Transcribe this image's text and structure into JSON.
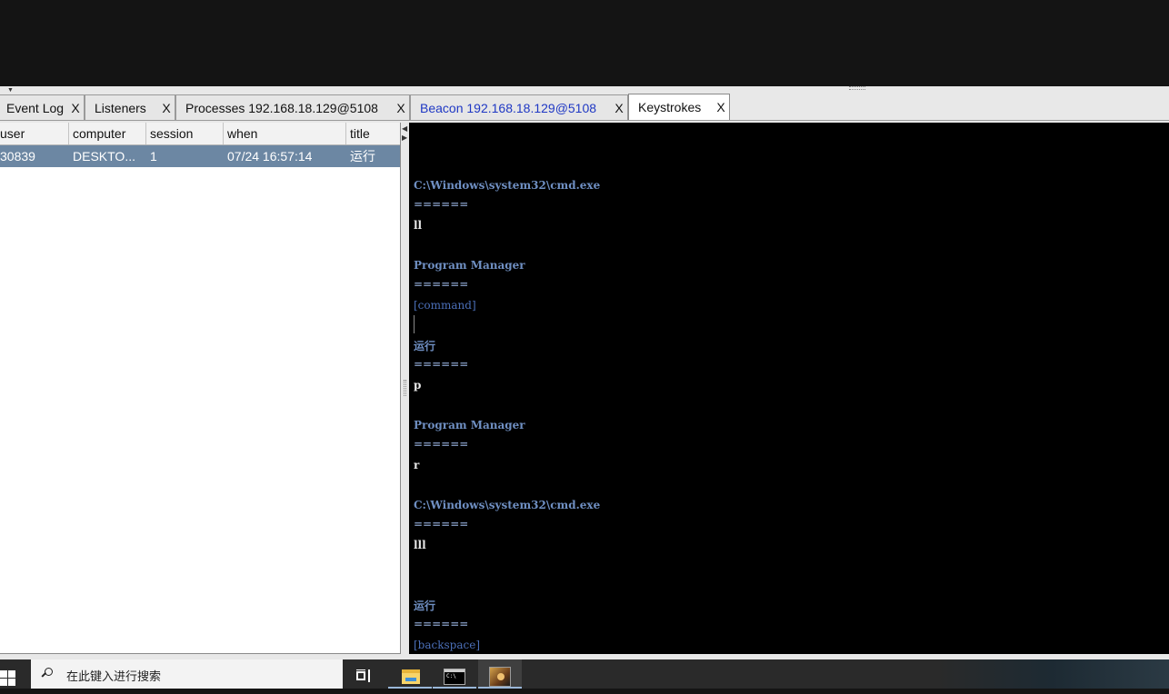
{
  "tabs": [
    {
      "label": "Event Log",
      "close": "X"
    },
    {
      "label": "Listeners",
      "close": "X"
    },
    {
      "label": "Processes 192.168.18.129@5108",
      "close": "X"
    },
    {
      "label": "Beacon 192.168.18.129@5108",
      "close": "X"
    },
    {
      "label": "Keystrokes",
      "close": "X"
    }
  ],
  "table": {
    "headers": [
      "user",
      "computer",
      "session",
      "when",
      "title"
    ],
    "rows": [
      [
        "30839",
        "DESKTO...",
        "1",
        "07/24 16:57:14",
        "运行"
      ]
    ]
  },
  "console": {
    "lines": [
      {
        "type": "win",
        "text": "C:\\Windows\\system32\\cmd.exe"
      },
      {
        "type": "sep",
        "text": "======"
      },
      {
        "type": "key",
        "text": "ll"
      },
      {
        "type": "win",
        "text": "Program Manager"
      },
      {
        "type": "sep",
        "text": "======"
      },
      {
        "type": "tag",
        "text": "[command]"
      },
      {
        "type": "win",
        "text": "运行"
      },
      {
        "type": "sep",
        "text": "======"
      },
      {
        "type": "key",
        "text": "p"
      },
      {
        "type": "win",
        "text": "Program Manager"
      },
      {
        "type": "sep",
        "text": "======"
      },
      {
        "type": "key",
        "text": "r"
      },
      {
        "type": "win",
        "text": "C:\\Windows\\system32\\cmd.exe"
      },
      {
        "type": "sep",
        "text": "======"
      },
      {
        "type": "key",
        "text": "lll"
      },
      {
        "type": "win",
        "text": "运行"
      },
      {
        "type": "sep",
        "text": "======"
      },
      {
        "type": "tag",
        "text": "[backspace]"
      }
    ]
  },
  "taskbar": {
    "search_placeholder": "在此键入进行搜索",
    "apps": [
      "task-view-icon",
      "file-explorer-icon",
      "cmd-icon",
      "cobalt-strike-icon"
    ]
  },
  "colors": {
    "selected_row": "#6c87a3",
    "console_bg": "#000000",
    "active_tab_text_blue": "#1f38c4"
  }
}
